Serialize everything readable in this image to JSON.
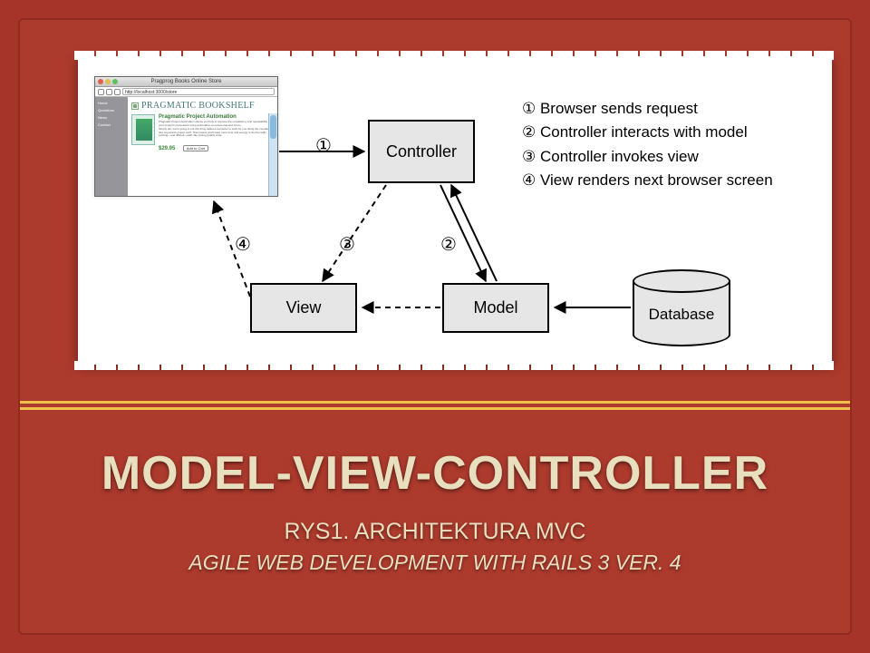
{
  "diagram": {
    "boxes": {
      "controller": "Controller",
      "view": "View",
      "model": "Model",
      "database": "Database"
    },
    "edge_labels": {
      "n1": "①",
      "n2": "②",
      "n3": "③",
      "n4": "④"
    },
    "steps": {
      "s1": "① Browser sends request",
      "s2": "② Controller interacts with model",
      "s3": "③ Controller invokes view",
      "s4": "④ View renders next browser screen"
    },
    "browser_mock": {
      "window_title": "Pragprog Books Online Store",
      "url": "http://localhost:3000/store",
      "banner": "PRAGMATIC BOOKSHELF",
      "side_items": [
        "Home",
        "Questions",
        "News",
        "Contact"
      ],
      "item_title": "Pragmatic Project Automation",
      "item_desc1": "Pragmatic Project Automation shows you how to improve the consistency and repeatability of your project's procedures using automation to reduce risk and errors.",
      "item_desc2": "Simply put, we're going to put this thing called a computer to work for you doing the mundane (but important) project stuff. That means you'll have more time and energy to do the really exciting—and difficult—stuff, like writing quality code.",
      "price": "$29.95",
      "button": "Add to Cart"
    }
  },
  "titles": {
    "main": "MODEL-VIEW-CONTROLLER",
    "sub1": "RYS1. ARCHITEKTURA MVC",
    "sub2": "AGILE WEB DEVELOPMENT WITH RAILS 3 VER. 4"
  }
}
